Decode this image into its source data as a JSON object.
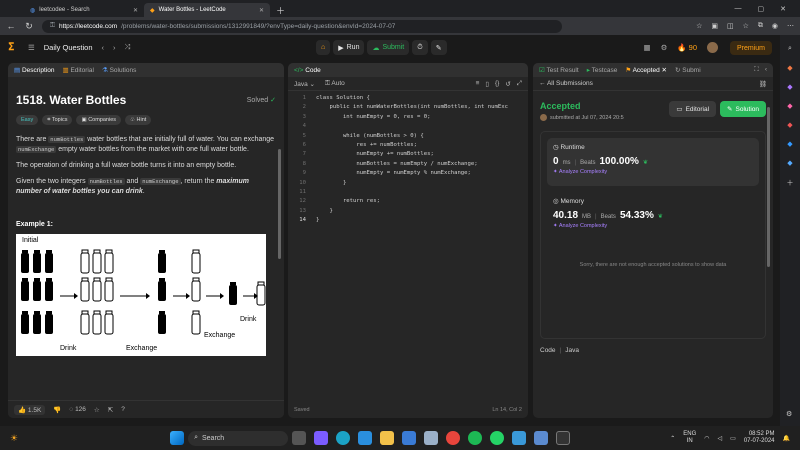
{
  "browser": {
    "tabs": [
      {
        "label": "leetcodee - Search"
      },
      {
        "label": "Water Bottles - LeetCode"
      }
    ],
    "url_host": "https://leetcode.com",
    "url_path": "/problems/water-bottles/submissions/1312991849/?envType=daily-question&envId=2024-07-07"
  },
  "nav": {
    "title": "Daily Question",
    "run": "Run",
    "submit": "Submit",
    "streak": "90",
    "premium": "Premium"
  },
  "left": {
    "tabs": [
      "Description",
      "Editorial",
      "Solutions"
    ],
    "title": "1518. Water Bottles",
    "solved": "Solved",
    "tags": [
      "Easy",
      "Topics",
      "Companies",
      "Hint"
    ],
    "p1a": "There are ",
    "p1code1": "numBottles",
    "p1b": " water bottles that are initially full of water. You can exchange ",
    "p1code2": "numExchange",
    "p1c": " empty water bottles from the market with one full water bottle.",
    "p2": "The operation of drinking a full water bottle turns it into an empty bottle.",
    "p3a": "Given the two integers ",
    "p3code1": "numBottles",
    "p3b": " and ",
    "p3code2": "numExchange",
    "p3c": ", return the ",
    "p3bold": "maximum number of water bottles you can drink",
    "p3d": ".",
    "example_heading": "Example 1:",
    "diagram": {
      "initial": "Initial",
      "drink1": "Drink",
      "exchange1": "Exchange",
      "exchange2": "Exchange",
      "drink2": "Drink"
    },
    "footer": {
      "likes": "1.5K",
      "comments": "126"
    }
  },
  "code": {
    "tab": "Code",
    "lang": "Java",
    "mode": "Auto",
    "lines": [
      "class Solution {",
      "    public int numWaterBottles(int numBottles, int numExc",
      "        int numEmpty = 0, res = 0;",
      "",
      "        while (numBottles > 0) {",
      "            res += numBottles;",
      "            numEmpty += numBottles;",
      "            numBottles = numEmpty / numExchange;",
      "            numEmpty = numEmpty % numExchange;",
      "        }",
      "",
      "        return res;",
      "    }",
      "}"
    ],
    "saved": "Saved",
    "cursor": "Ln 14, Col 2"
  },
  "right": {
    "tabs": [
      "Test Result",
      "Testcase",
      "Accepted",
      "Submi"
    ],
    "back": "All Submissions",
    "status": "Accepted",
    "submitted": "submitted at Jul 07, 2024 20:5",
    "editorial_btn": "Editorial",
    "solution_btn": "Solution",
    "runtime_label": "Runtime",
    "runtime_value": "0",
    "runtime_unit": "ms",
    "beats": "Beats",
    "runtime_pct": "100.00%",
    "analyze": "Analyze Complexity",
    "memory_label": "Memory",
    "memory_value": "40.18",
    "memory_unit": "MB",
    "memory_pct": "54.33%",
    "empty_msg": "Sorry, there are not enough accepted solutions to show data",
    "code_label": "Code",
    "code_lang": "Java"
  },
  "taskbar": {
    "search": "Search",
    "lang1": "ENG",
    "lang2": "IN",
    "time": "08:52 PM",
    "date": "07-07-2024"
  }
}
